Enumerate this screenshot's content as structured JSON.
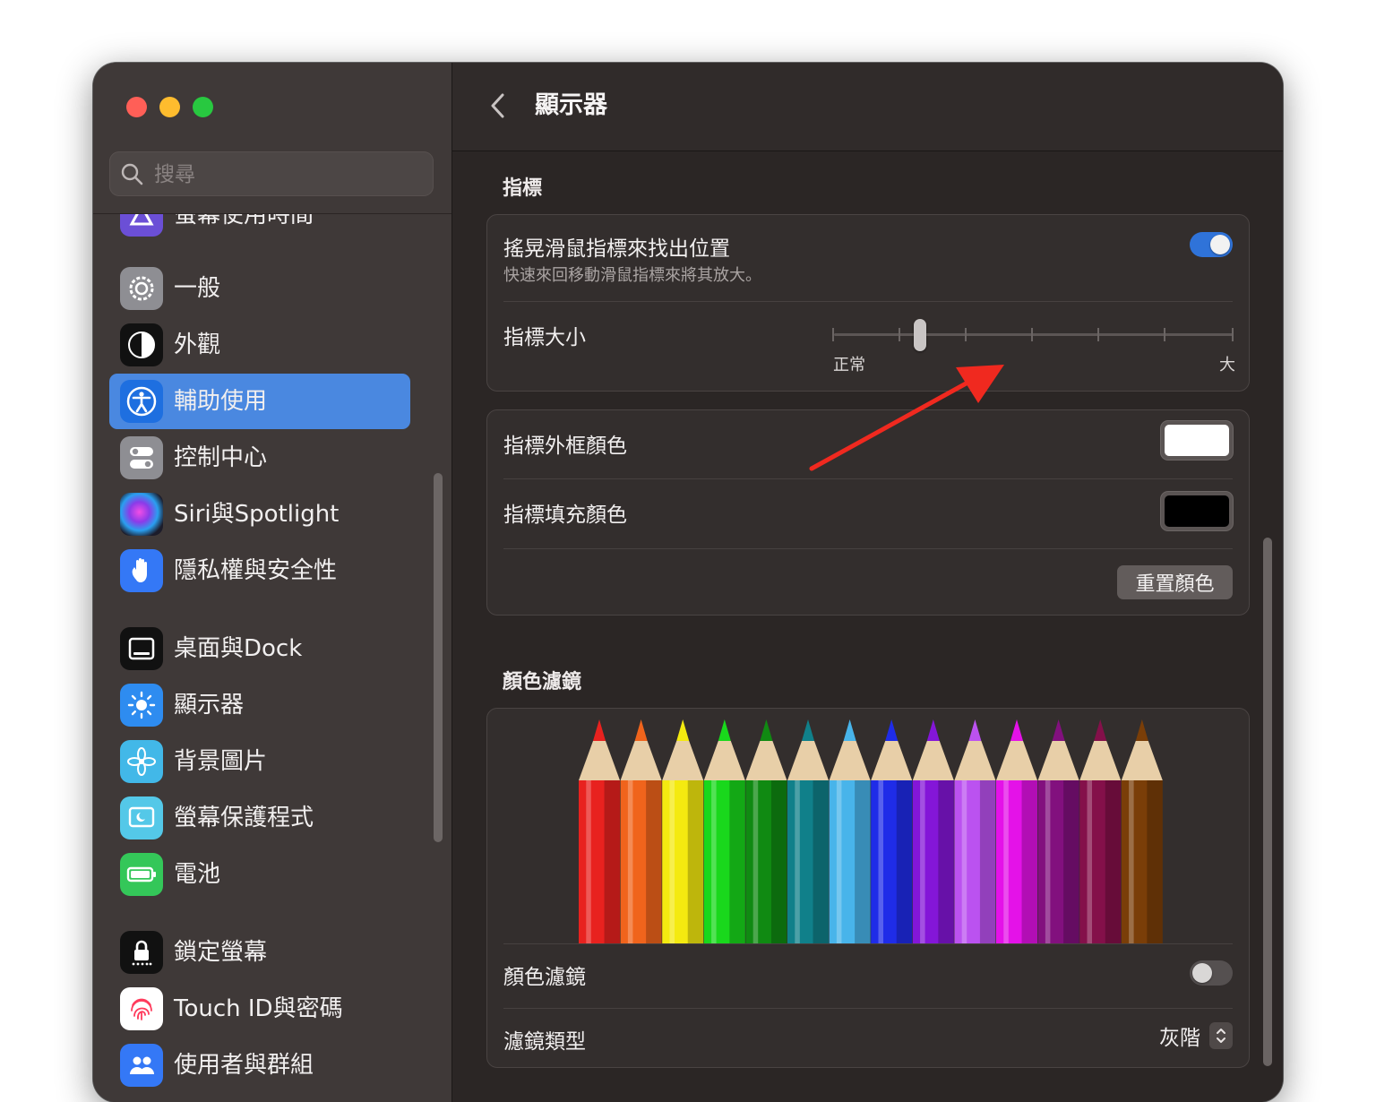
{
  "window": {
    "traffic_lights": [
      "close",
      "minimize",
      "zoom"
    ]
  },
  "search": {
    "placeholder": "搜尋"
  },
  "sidebar": {
    "items": [
      {
        "label": "螢幕使用時間",
        "icon": "screen-time-icon"
      },
      {
        "label": "一般",
        "icon": "gear-icon"
      },
      {
        "label": "外觀",
        "icon": "appearance-icon"
      },
      {
        "label": "輔助使用",
        "icon": "accessibility-icon",
        "selected": true
      },
      {
        "label": "控制中心",
        "icon": "control-center-icon"
      },
      {
        "label": "Siri與Spotlight",
        "icon": "siri-icon"
      },
      {
        "label": "隱私權與安全性",
        "icon": "hand-icon"
      },
      {
        "label": "桌面與Dock",
        "icon": "dock-icon"
      },
      {
        "label": "顯示器",
        "icon": "display-sun-icon"
      },
      {
        "label": "背景圖片",
        "icon": "wallpaper-flower-icon"
      },
      {
        "label": "螢幕保護程式",
        "icon": "screensaver-icon"
      },
      {
        "label": "電池",
        "icon": "battery-icon"
      },
      {
        "label": "鎖定螢幕",
        "icon": "lock-icon"
      },
      {
        "label": "Touch ID與密碼",
        "icon": "fingerprint-icon"
      },
      {
        "label": "使用者與群組",
        "icon": "users-icon"
      }
    ]
  },
  "header": {
    "title": "顯示器"
  },
  "pointer": {
    "section_title": "指標",
    "shake": {
      "label": "搖晃滑鼠指標來找出位置",
      "description": "快速來回移動滑鼠指標來將其放大。",
      "enabled": true
    },
    "size": {
      "label": "指標大小",
      "min_label": "正常",
      "max_label": "大",
      "value_fraction": 0.22
    },
    "outline_color": {
      "label": "指標外框顏色",
      "color": "#ffffff"
    },
    "fill_color": {
      "label": "指標填充顏色",
      "color": "#000000"
    },
    "reset_label": "重置顏色"
  },
  "color_filters": {
    "section_title": "顏色濾鏡",
    "pencil_colors": [
      "#e8221f",
      "#f0641c",
      "#f4ea10",
      "#19d81c",
      "#108a12",
      "#10808a",
      "#48b4ea",
      "#1f2ce8",
      "#8416d8",
      "#bb52f0",
      "#e412e8",
      "#82107e",
      "#84104a",
      "#7a3e08"
    ],
    "toggle_label": "顏色濾鏡",
    "enabled": false,
    "type_label": "濾鏡類型",
    "type_value": "灰階"
  },
  "colors": {
    "accent": "#2f73d9",
    "selection": "#4a88e0",
    "annotation_arrow": "#f0291f"
  }
}
